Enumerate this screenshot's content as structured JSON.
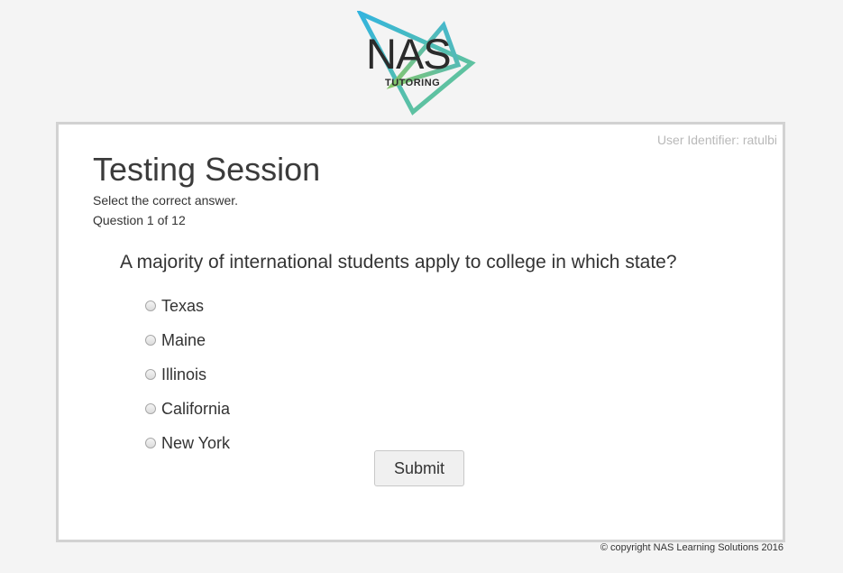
{
  "logo": {
    "name": "NAS",
    "subtitle": "TUTORING",
    "colors": [
      "#35b5d8",
      "#5cc49a",
      "#8bc56c"
    ]
  },
  "user_identifier": "User Identifier: ratulbi",
  "page_title": "Testing Session",
  "instructions": "Select the correct answer.",
  "progress": {
    "text": "Question 1 of 12",
    "current": 1,
    "total": 12
  },
  "question": "A majority of international students apply to college in which state?",
  "options": [
    "Texas",
    "Maine",
    "Illinois",
    "California",
    "New York"
  ],
  "submit_label": "Submit",
  "footer": "© copyright NAS Learning Solutions 2016"
}
